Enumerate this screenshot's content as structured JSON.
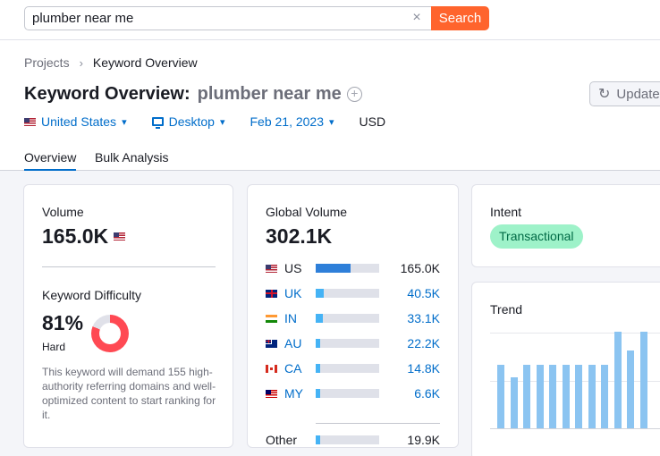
{
  "search": {
    "value": "plumber near me",
    "clear_icon": "×",
    "button": "Search"
  },
  "breadcrumb": {
    "root": "Projects",
    "current": "Keyword Overview"
  },
  "title": {
    "prefix": "Keyword Overview:",
    "keyword": "plumber near me",
    "add_icon": "+"
  },
  "update_button": {
    "icon": "↻",
    "label": "Update"
  },
  "filters": {
    "database": "United States",
    "device": "Desktop",
    "date": "Feb 21, 2023",
    "currency": "USD"
  },
  "tabs": [
    {
      "label": "Overview",
      "active": true
    },
    {
      "label": "Bulk Analysis",
      "active": false
    }
  ],
  "volume_card": {
    "label": "Volume",
    "value": "165.0K",
    "kd_label": "Keyword Difficulty",
    "kd_value": "81%",
    "kd_percent": 81,
    "kd_level": "Hard",
    "kd_description": "This keyword will demand 155 high-authority referring domains and well-optimized content to start ranking for it."
  },
  "global_volume": {
    "label": "Global Volume",
    "value": "302.1K",
    "rows": [
      {
        "code": "US",
        "value": "165.0K",
        "share": 0.55,
        "flag": "flag-us",
        "linked": false
      },
      {
        "code": "UK",
        "value": "40.5K",
        "share": 0.13,
        "flag": "flag-uk",
        "linked": true
      },
      {
        "code": "IN",
        "value": "33.1K",
        "share": 0.11,
        "flag": "flag-in",
        "linked": true
      },
      {
        "code": "AU",
        "value": "22.2K",
        "share": 0.07,
        "flag": "flag-au",
        "linked": true
      },
      {
        "code": "CA",
        "value": "14.8K",
        "share": 0.05,
        "flag": "flag-ca",
        "linked": true
      },
      {
        "code": "MY",
        "value": "6.6K",
        "share": 0.02,
        "flag": "flag-my",
        "linked": true
      }
    ],
    "other": {
      "label": "Other",
      "value": "19.9K",
      "share": 0.07
    }
  },
  "intent": {
    "label": "Intent",
    "badge": "Transactional"
  },
  "trend": {
    "label": "Trend",
    "values": [
      0.66,
      0.53,
      0.66,
      0.66,
      0.66,
      0.66,
      0.66,
      0.66,
      0.66,
      1.0,
      0.81,
      1.0
    ]
  },
  "colors": {
    "accent": "#006dca",
    "search_button": "#ff642d",
    "kd_hard": "#ff4953",
    "bar_primary": "#2e7fd9",
    "bar_secondary": "#45b3f5",
    "intent_bg": "#9ef2c9",
    "trend_bar": "#8bc4f1"
  }
}
